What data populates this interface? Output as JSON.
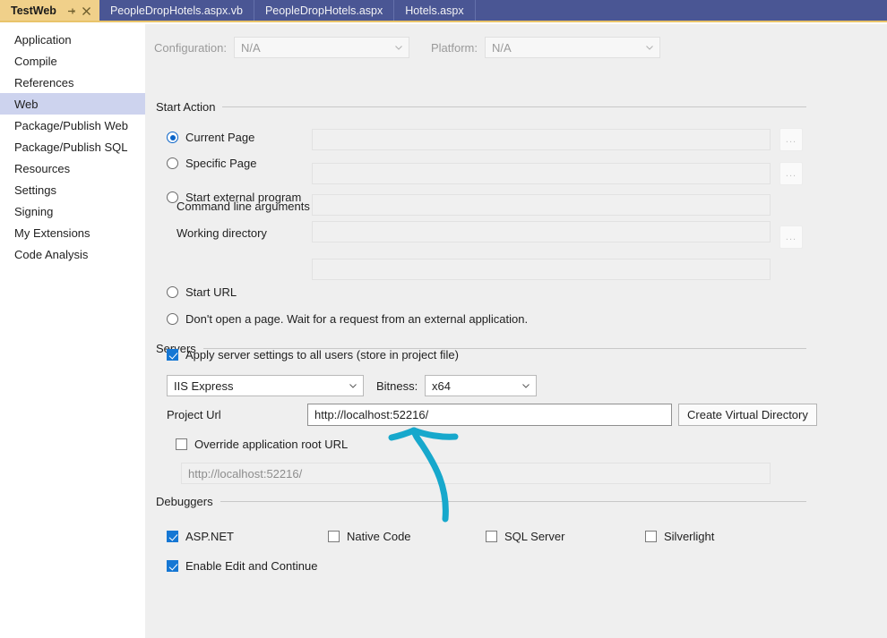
{
  "window": {
    "tabs": [
      {
        "label": "TestWeb",
        "active": true,
        "pin_icon": "pin-icon",
        "close_icon": "close-icon"
      },
      {
        "label": "PeopleDropHotels.aspx.vb",
        "active": false
      },
      {
        "label": "PeopleDropHotels.aspx",
        "active": false
      },
      {
        "label": "Hotels.aspx",
        "active": false
      }
    ]
  },
  "sidebar": {
    "items": [
      {
        "label": "Application",
        "selected": false
      },
      {
        "label": "Compile",
        "selected": false
      },
      {
        "label": "References",
        "selected": false
      },
      {
        "label": "Web",
        "selected": true
      },
      {
        "label": "Package/Publish Web",
        "selected": false
      },
      {
        "label": "Package/Publish SQL",
        "selected": false
      },
      {
        "label": "Resources",
        "selected": false
      },
      {
        "label": "Settings",
        "selected": false
      },
      {
        "label": "Signing",
        "selected": false
      },
      {
        "label": "My Extensions",
        "selected": false
      },
      {
        "label": "Code Analysis",
        "selected": false
      }
    ]
  },
  "toolbar": {
    "configuration_label": "Configuration:",
    "configuration_value": "N/A",
    "platform_label": "Platform:",
    "platform_value": "N/A"
  },
  "start_action": {
    "group_title": "Start Action",
    "options": [
      {
        "label": "Current Page",
        "checked": true
      },
      {
        "label": "Specific Page",
        "checked": false
      },
      {
        "label": "Start external program",
        "checked": false
      },
      {
        "label": "Start URL",
        "checked": false
      },
      {
        "label": "Don't open a page.  Wait for a request from an external application.",
        "checked": false
      }
    ],
    "specific_page_value": "",
    "external_program_value": "",
    "command_line_label": "Command line arguments",
    "command_line_value": "",
    "working_directory_label": "Working directory",
    "working_directory_value": "",
    "start_url_value": "",
    "browse_button_label": "..."
  },
  "servers": {
    "group_title": "Servers",
    "apply_all_users_label": "Apply server settings to all users (store in project file)",
    "apply_all_users_checked": true,
    "server_value": "IIS Express",
    "bitness_label": "Bitness:",
    "bitness_value": "x64",
    "project_url_label": "Project Url",
    "project_url_value": "http://localhost:52216/",
    "create_virtual_directory_label": "Create Virtual Directory",
    "override_root_label": "Override application root URL",
    "override_root_checked": false,
    "override_root_value": "http://localhost:52216/"
  },
  "debuggers": {
    "group_title": "Debuggers",
    "options": [
      {
        "label": "ASP.NET",
        "checked": true
      },
      {
        "label": "Native Code",
        "checked": false
      },
      {
        "label": "SQL Server",
        "checked": false
      },
      {
        "label": "Silverlight",
        "checked": false
      }
    ],
    "edit_and_continue_label": "Enable Edit and Continue",
    "edit_and_continue_checked": true
  },
  "annotation": {
    "color": "#17a8cc",
    "shape": "hand-drawn-arrow-pointing-up-to-project-url"
  }
}
